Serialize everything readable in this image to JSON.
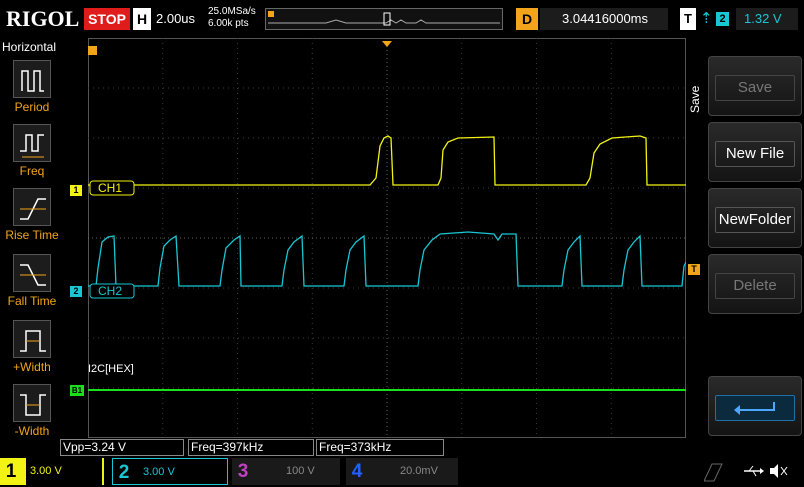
{
  "header": {
    "brand": "RIGOL",
    "run_state": "STOP",
    "timebase_key": "H",
    "timebase": "2.00us",
    "sample_rate": "25.0MSa/s",
    "memory_depth": "6.00k pts",
    "delay_key": "D",
    "delay": "3.04416000ms",
    "trigger_key": "T",
    "trigger_edge": "⇡",
    "trigger_source": "2",
    "trigger_level": "1.32 V"
  },
  "left_panel": {
    "title": "Horizontal",
    "items": [
      {
        "label": "Period"
      },
      {
        "label": "Freq"
      },
      {
        "label": "Rise Time"
      },
      {
        "label": "Fall Time"
      },
      {
        "label": "+Width"
      },
      {
        "label": "-Width"
      }
    ]
  },
  "waveform": {
    "ch1_tag": "CH1",
    "ch1_marker": "1",
    "ch2_tag": "CH2",
    "ch2_marker": "2",
    "bus_label": "I2C[HEX]",
    "bus_marker": "B1",
    "trigger_marker": "T"
  },
  "measurements": [
    {
      "text": "Vpp=3.24 V"
    },
    {
      "text": "Freq=397kHz"
    },
    {
      "text": "Freq=373kHz"
    }
  ],
  "right_panel": {
    "tab": "Save",
    "buttons": [
      {
        "label": "Save",
        "enabled": false
      },
      {
        "label": "New File",
        "enabled": true
      },
      {
        "label": "NewFolder",
        "enabled": true
      },
      {
        "label": "Delete",
        "enabled": false
      }
    ]
  },
  "channels": [
    {
      "num": "1",
      "scale": "3.00 V",
      "color": "#f2f214"
    },
    {
      "num": "2",
      "scale": "3.00 V",
      "color": "#19c6d4"
    },
    {
      "num": "3",
      "scale": "100 V",
      "color": "#c040c0"
    },
    {
      "num": "4",
      "scale": "20.0mV",
      "color": "#2060ff"
    }
  ],
  "colors": {
    "ch1": "#f2f214",
    "ch2": "#19c6d4",
    "bus": "#19e019",
    "accent": "#f2a51a",
    "stop": "#e01b1b"
  }
}
